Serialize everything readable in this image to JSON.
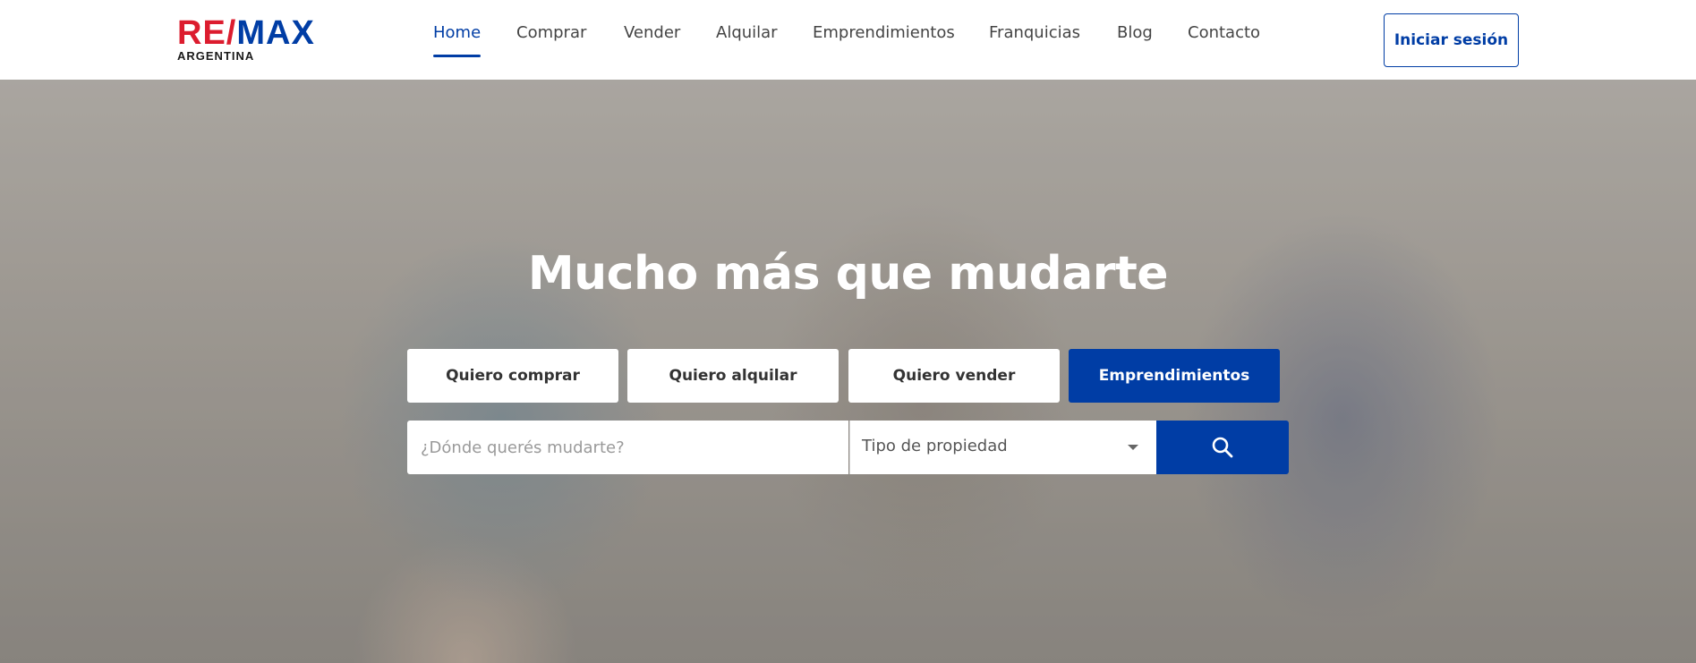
{
  "brand": {
    "logo_re": "RE",
    "logo_slash": "/",
    "logo_max": "MAX",
    "logo_sub": "ARGENTINA",
    "colors": {
      "primary": "#003da5",
      "accent": "#dc1c2e"
    }
  },
  "nav": {
    "items": [
      {
        "label": "Home",
        "active": true
      },
      {
        "label": "Comprar"
      },
      {
        "label": "Vender"
      },
      {
        "label": "Alquilar"
      },
      {
        "label": "Emprendimientos"
      },
      {
        "label": "Franquicias"
      },
      {
        "label": "Blog"
      },
      {
        "label": "Contacto"
      }
    ],
    "login_label": "Iniciar sesión"
  },
  "hero": {
    "title": "Mucho más que mudarte",
    "tabs": [
      {
        "label": "Quiero comprar"
      },
      {
        "label": "Quiero alquilar"
      },
      {
        "label": "Quiero vender"
      },
      {
        "label": "Emprendimientos",
        "active": true
      }
    ],
    "search": {
      "placeholder": "¿Dónde querés mudarte?",
      "property_type": "Tipo de propiedad",
      "search_icon": "search-icon"
    }
  }
}
